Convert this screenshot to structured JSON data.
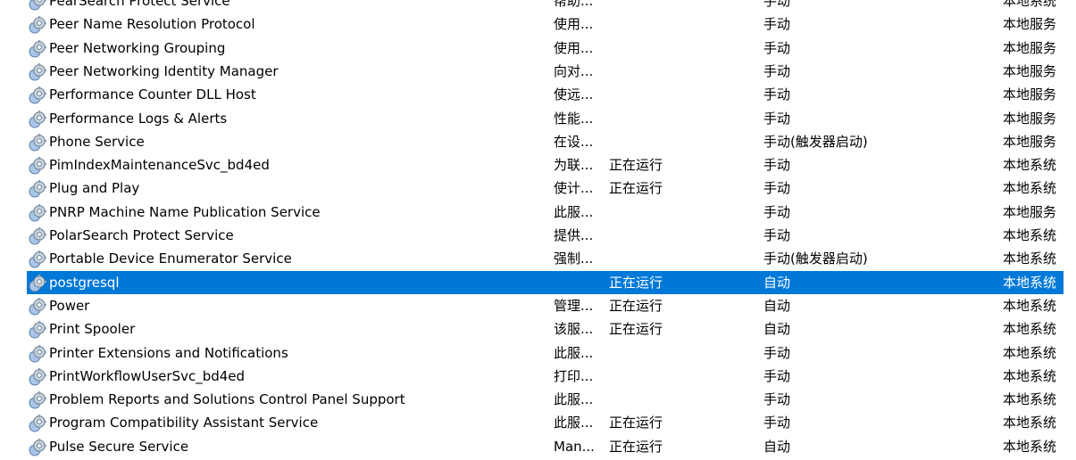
{
  "services": [
    {
      "name": "PearSearch Protect Service",
      "desc": "帮助...",
      "status": "",
      "startup": "手动",
      "logon": "本地系统"
    },
    {
      "name": "Peer Name Resolution Protocol",
      "desc": "使用...",
      "status": "",
      "startup": "手动",
      "logon": "本地服务"
    },
    {
      "name": "Peer Networking Grouping",
      "desc": "使用...",
      "status": "",
      "startup": "手动",
      "logon": "本地服务"
    },
    {
      "name": "Peer Networking Identity Manager",
      "desc": "向对...",
      "status": "",
      "startup": "手动",
      "logon": "本地服务"
    },
    {
      "name": "Performance Counter DLL Host",
      "desc": "使远...",
      "status": "",
      "startup": "手动",
      "logon": "本地服务"
    },
    {
      "name": "Performance Logs & Alerts",
      "desc": "性能...",
      "status": "",
      "startup": "手动",
      "logon": "本地服务"
    },
    {
      "name": "Phone Service",
      "desc": "在设...",
      "status": "",
      "startup": "手动(触发器启动)",
      "logon": "本地服务"
    },
    {
      "name": "PimIndexMaintenanceSvc_bd4ed",
      "desc": "为联...",
      "status": "正在运行",
      "startup": "手动",
      "logon": "本地系统"
    },
    {
      "name": "Plug and Play",
      "desc": "使计...",
      "status": "正在运行",
      "startup": "手动",
      "logon": "本地系统"
    },
    {
      "name": "PNRP Machine Name Publication Service",
      "desc": "此服...",
      "status": "",
      "startup": "手动",
      "logon": "本地服务"
    },
    {
      "name": "PolarSearch Protect Service",
      "desc": "提供...",
      "status": "",
      "startup": "手动",
      "logon": "本地系统"
    },
    {
      "name": "Portable Device Enumerator Service",
      "desc": "强制...",
      "status": "",
      "startup": "手动(触发器启动)",
      "logon": "本地系统"
    },
    {
      "name": "postgresql",
      "desc": "",
      "status": "正在运行",
      "startup": "自动",
      "logon": "本地系统",
      "selected": true
    },
    {
      "name": "Power",
      "desc": "管理...",
      "status": "正在运行",
      "startup": "自动",
      "logon": "本地系统"
    },
    {
      "name": "Print Spooler",
      "desc": "该服...",
      "status": "正在运行",
      "startup": "自动",
      "logon": "本地系统"
    },
    {
      "name": "Printer Extensions and Notifications",
      "desc": "此服...",
      "status": "",
      "startup": "手动",
      "logon": "本地系统"
    },
    {
      "name": "PrintWorkflowUserSvc_bd4ed",
      "desc": "打印...",
      "status": "",
      "startup": "手动",
      "logon": "本地系统"
    },
    {
      "name": "Problem Reports and Solutions Control Panel Support",
      "desc": "此服...",
      "status": "",
      "startup": "手动",
      "logon": "本地系统"
    },
    {
      "name": "Program Compatibility Assistant Service",
      "desc": "此服...",
      "status": "正在运行",
      "startup": "手动",
      "logon": "本地系统"
    },
    {
      "name": "Pulse Secure Service",
      "desc": "Man...",
      "status": "正在运行",
      "startup": "自动",
      "logon": "本地系统"
    }
  ],
  "icon": "gear-icon",
  "colors": {
    "selection": "#0078d7",
    "selection_text": "#ffffff",
    "text": "#000000"
  }
}
